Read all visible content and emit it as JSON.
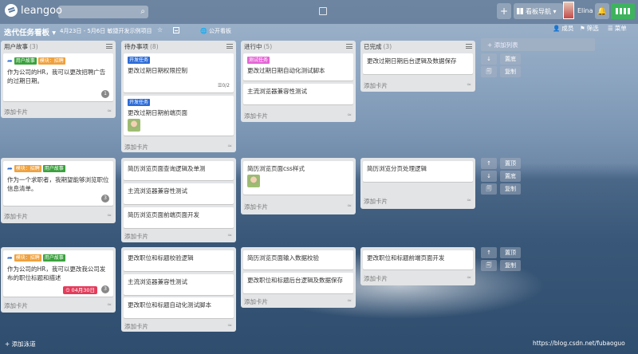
{
  "app": {
    "logo_text": "leangoo"
  },
  "topbar": {
    "add_label": "+",
    "board_nav_label": "看板导航 ▾",
    "user_name": "Elina"
  },
  "board": {
    "title": "迭代任务看板 ▾",
    "date_range": "4月23日 - 5月6日",
    "description": "敏捷开发示例项目",
    "public_label": "公开看板",
    "members_label": "成员",
    "filter_label": "筛选",
    "menu_label": "菜单"
  },
  "lists": {
    "stories": {
      "title": "用户故事",
      "count": "(3)"
    },
    "todo": {
      "title": "待办事项",
      "count": "(8)"
    },
    "doing": {
      "title": "进行中",
      "count": "(5)"
    },
    "done": {
      "title": "已完成",
      "count": "(3)"
    }
  },
  "add_list_label": "+ 添加列表",
  "add_card_label": "添加卡片",
  "add_lane_label": "+ 添加泳道",
  "actions": {
    "bottom": "置底",
    "top": "置顶",
    "copy": "复制"
  },
  "tags": {
    "user_story": "用户故事",
    "module_recruit": "模块：招聘",
    "dev_task": "开发任务",
    "test_task": "测试任务"
  },
  "lanes": [
    {
      "story": {
        "text": "作为公司的HR，我可以更改招聘广告的过期日期。",
        "badge": "1"
      },
      "todo": [
        {
          "text": "更改过期日期权限控制",
          "checklist": "0/2"
        },
        {
          "text": "更改过期日期前端页面"
        }
      ],
      "doing": [
        {
          "text": "更改过期日期自动化测试脚本"
        },
        {
          "text": "主流浏览器兼容性测试"
        }
      ],
      "done": [
        {
          "text": "更改过期日期后台逻辑及数据保存"
        }
      ]
    },
    {
      "story": {
        "text": "作为一个求职者，我期望能够浏览职位信息清单。",
        "badge": "3"
      },
      "todo": [
        {
          "text": "简历浏览页面查询逻辑及单测"
        },
        {
          "text": "主流浏览器兼容性测试"
        },
        {
          "text": "简历浏览页面前端页面开发"
        }
      ],
      "doing": [
        {
          "text": "简历浏览页面css样式"
        }
      ],
      "done": [
        {
          "text": "简历浏览分页处理逻辑"
        }
      ]
    },
    {
      "story": {
        "text": "作为公司的HR，我可以更改我公司发布的职位标题和描述",
        "badge": "3",
        "due": "04月30日"
      },
      "todo": [
        {
          "text": "更改职位和标题校验逻辑"
        },
        {
          "text": "主流浏览器兼容性测试"
        },
        {
          "text": "更改职位和标题自动化测试脚本"
        }
      ],
      "doing": [
        {
          "text": "简历浏览页面输入数据校验"
        },
        {
          "text": "更改职位和标题后台逻辑及数据保存"
        }
      ],
      "done": [
        {
          "text": "更改职位和标题前端页面开发"
        }
      ]
    }
  ],
  "watermark": "https://blog.csdn.net/fubaoguo"
}
